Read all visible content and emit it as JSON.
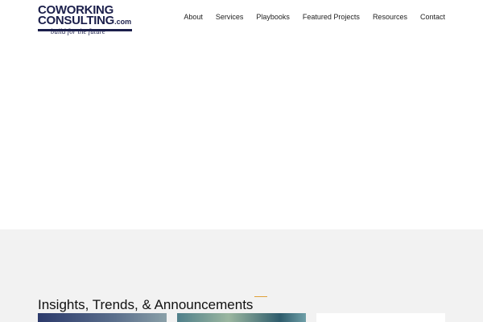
{
  "header": {
    "logo": {
      "line1": "COWORKING",
      "line2": "CONSULTING",
      "dotcom": ".com",
      "tagline": "build for the future"
    },
    "nav": [
      "About",
      "Services",
      "Playbooks",
      "Featured Projects",
      "Resources",
      "Contact"
    ]
  },
  "insights": {
    "title": "Insights, Trends, & Announcements",
    "accent_color": "#e0a23a"
  }
}
